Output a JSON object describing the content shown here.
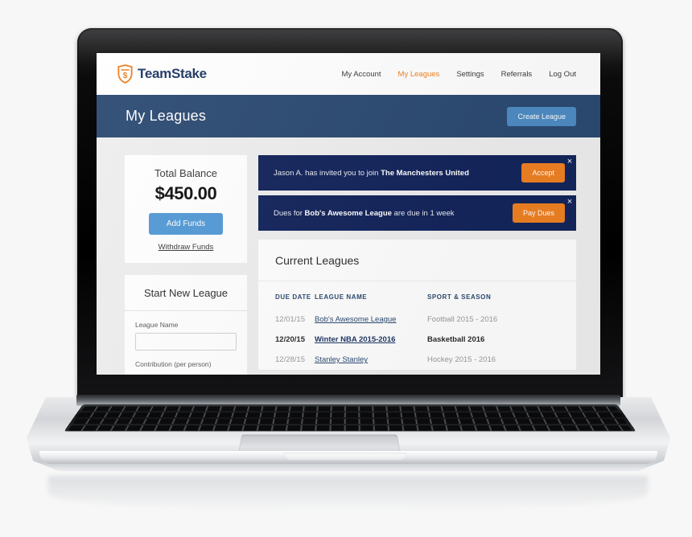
{
  "brand": {
    "name": "TeamStake",
    "logo_icon": "shield-dollar-icon",
    "logo_color": "#ef8122"
  },
  "nav": {
    "items": [
      {
        "label": "My Account",
        "active": false
      },
      {
        "label": "My Leagues",
        "active": true
      },
      {
        "label": "Settings",
        "active": false
      },
      {
        "label": "Referrals",
        "active": false
      },
      {
        "label": "Log Out",
        "active": false
      }
    ]
  },
  "page_header": {
    "title": "My Leagues",
    "create_button": "Create League",
    "bg_color": "#2c4a72",
    "button_color": "#4e8bc4"
  },
  "balance_card": {
    "title": "Total Balance",
    "amount": "$450.00",
    "add_funds_label": "Add Funds",
    "withdraw_label": "Withdraw Funds",
    "button_color": "#549ad6"
  },
  "new_league_card": {
    "title": "Start New League",
    "fields": [
      {
        "label": "League Name",
        "value": "",
        "placeholder": ""
      },
      {
        "label": "Contribution (per person)",
        "value": "",
        "placeholder": ""
      }
    ]
  },
  "banners": [
    {
      "text_before": "Jason A. has invited you to join ",
      "text_bold": "The Manchesters United",
      "text_after": "",
      "button": "Accept",
      "close": "×",
      "bg_color": "#14255c",
      "button_color": "#ef8122"
    },
    {
      "text_before": "Dues for ",
      "text_bold": "Bob's Awesome League",
      "text_after": " are due in 1 week",
      "button": "Pay Dues",
      "close": "×",
      "bg_color": "#14255c",
      "button_color": "#ef8122"
    }
  ],
  "leagues": {
    "title": "Current Leagues",
    "columns": [
      "DUE DATE",
      "LEAGUE NAME",
      "SPORT & SEASON"
    ],
    "rows": [
      {
        "due_date": "12/01/15",
        "league_name": "Bob's Awesome League",
        "sport_season": "Football 2015 - 2016",
        "emphasis": false
      },
      {
        "due_date": "12/20/15",
        "league_name": "Winter NBA 2015-2016",
        "sport_season": "Basketball 2016",
        "emphasis": true
      },
      {
        "due_date": "12/28/15",
        "league_name": "Stanley Stanley",
        "sport_season": "Hockey 2015 - 2016",
        "emphasis": false
      }
    ]
  }
}
